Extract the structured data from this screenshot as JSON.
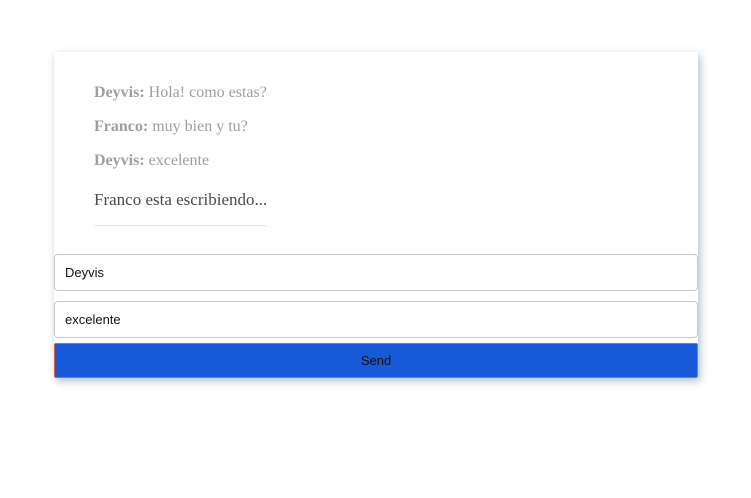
{
  "messages": [
    {
      "handle": "Deyvis:",
      "text": "Hola! como estas?"
    },
    {
      "handle": "Franco:",
      "text": "muy bien y tu?"
    },
    {
      "handle": "Deyvis:",
      "text": "excelente"
    }
  ],
  "typing_indicator": "Franco esta escribiendo...",
  "form": {
    "handle_value": "Deyvis",
    "message_value": "excelente",
    "send_label": "Send"
  },
  "colors": {
    "send_button_bg": "#1859d9",
    "message_text": "#9e9e9e"
  }
}
